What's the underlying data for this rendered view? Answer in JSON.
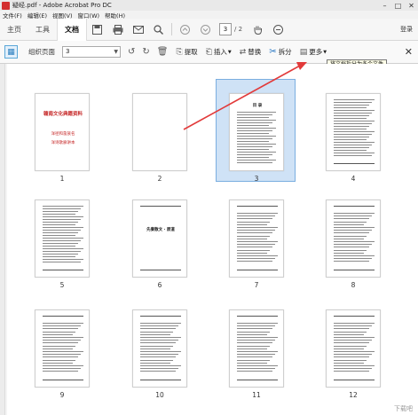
{
  "window": {
    "title": "疑经.pdf - Adobe Acrobat Pro DC"
  },
  "menu": [
    "文件(F)",
    "编辑(E)",
    "视图(V)",
    "窗口(W)",
    "帮助(H)"
  ],
  "tabs": [
    {
      "label": "主页",
      "active": false
    },
    {
      "label": "工具",
      "active": false
    },
    {
      "label": "文档",
      "active": true
    }
  ],
  "toolbar": {
    "page_current": "3",
    "page_total": "/ 2",
    "login": "登录"
  },
  "organize": {
    "title": "组织页面",
    "range_value": "3",
    "extract": "提取",
    "insert": "插入",
    "replace": "替换",
    "split": "拆分",
    "more": "更多",
    "tooltip": "将文档拆分为多个文件"
  },
  "pages": [
    {
      "num": "1",
      "kind": "cover",
      "cover_title": "赣南文化典籍资料",
      "cover_sub1": "洋径和畲族名",
      "cover_sub2": "洋诗歌廊讲本"
    },
    {
      "num": "2",
      "kind": "blank"
    },
    {
      "num": "3",
      "kind": "toc",
      "heading": "目  录",
      "selected": true
    },
    {
      "num": "4",
      "kind": "toc2"
    },
    {
      "num": "5",
      "kind": "toc2"
    },
    {
      "num": "6",
      "kind": "title",
      "heading": "先秦散文 · 原道"
    },
    {
      "num": "7",
      "kind": "text"
    },
    {
      "num": "8",
      "kind": "text"
    },
    {
      "num": "9",
      "kind": "text"
    },
    {
      "num": "10",
      "kind": "text"
    },
    {
      "num": "11",
      "kind": "text"
    },
    {
      "num": "12",
      "kind": "text"
    }
  ],
  "watermark": "下载吧"
}
